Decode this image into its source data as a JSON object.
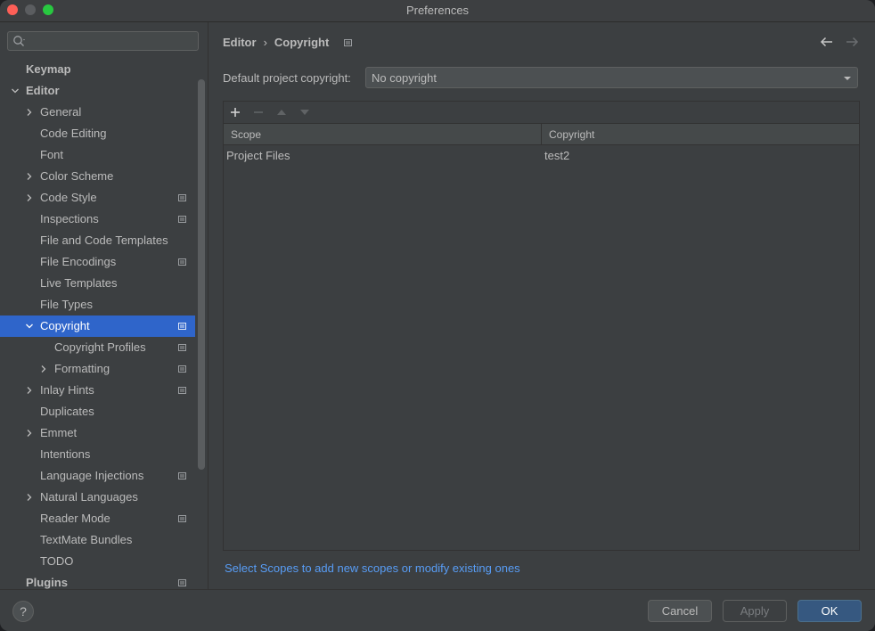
{
  "window": {
    "title": "Preferences"
  },
  "search": {
    "placeholder": ""
  },
  "tree": [
    {
      "label": "Keymap",
      "level": 0,
      "bold": true,
      "arrow": "none",
      "project": false,
      "selected": false
    },
    {
      "label": "Editor",
      "level": 0,
      "bold": true,
      "arrow": "down",
      "project": false,
      "selected": false
    },
    {
      "label": "General",
      "level": 1,
      "bold": false,
      "arrow": "right",
      "project": false,
      "selected": false
    },
    {
      "label": "Code Editing",
      "level": 1,
      "bold": false,
      "arrow": "none",
      "project": false,
      "selected": false
    },
    {
      "label": "Font",
      "level": 1,
      "bold": false,
      "arrow": "none",
      "project": false,
      "selected": false
    },
    {
      "label": "Color Scheme",
      "level": 1,
      "bold": false,
      "arrow": "right",
      "project": false,
      "selected": false
    },
    {
      "label": "Code Style",
      "level": 1,
      "bold": false,
      "arrow": "right",
      "project": true,
      "selected": false
    },
    {
      "label": "Inspections",
      "level": 1,
      "bold": false,
      "arrow": "none",
      "project": true,
      "selected": false
    },
    {
      "label": "File and Code Templates",
      "level": 1,
      "bold": false,
      "arrow": "none",
      "project": false,
      "selected": false
    },
    {
      "label": "File Encodings",
      "level": 1,
      "bold": false,
      "arrow": "none",
      "project": true,
      "selected": false
    },
    {
      "label": "Live Templates",
      "level": 1,
      "bold": false,
      "arrow": "none",
      "project": false,
      "selected": false
    },
    {
      "label": "File Types",
      "level": 1,
      "bold": false,
      "arrow": "none",
      "project": false,
      "selected": false
    },
    {
      "label": "Copyright",
      "level": 1,
      "bold": false,
      "arrow": "down",
      "project": true,
      "selected": true
    },
    {
      "label": "Copyright Profiles",
      "level": 2,
      "bold": false,
      "arrow": "none",
      "project": true,
      "selected": false
    },
    {
      "label": "Formatting",
      "level": 2,
      "bold": false,
      "arrow": "right",
      "project": true,
      "selected": false
    },
    {
      "label": "Inlay Hints",
      "level": 1,
      "bold": false,
      "arrow": "right",
      "project": true,
      "selected": false
    },
    {
      "label": "Duplicates",
      "level": 1,
      "bold": false,
      "arrow": "none",
      "project": false,
      "selected": false
    },
    {
      "label": "Emmet",
      "level": 1,
      "bold": false,
      "arrow": "right",
      "project": false,
      "selected": false
    },
    {
      "label": "Intentions",
      "level": 1,
      "bold": false,
      "arrow": "none",
      "project": false,
      "selected": false
    },
    {
      "label": "Language Injections",
      "level": 1,
      "bold": false,
      "arrow": "none",
      "project": true,
      "selected": false
    },
    {
      "label": "Natural Languages",
      "level": 1,
      "bold": false,
      "arrow": "right",
      "project": false,
      "selected": false
    },
    {
      "label": "Reader Mode",
      "level": 1,
      "bold": false,
      "arrow": "none",
      "project": true,
      "selected": false
    },
    {
      "label": "TextMate Bundles",
      "level": 1,
      "bold": false,
      "arrow": "none",
      "project": false,
      "selected": false
    },
    {
      "label": "TODO",
      "level": 1,
      "bold": false,
      "arrow": "none",
      "project": false,
      "selected": false
    },
    {
      "label": "Plugins",
      "level": 0,
      "bold": true,
      "arrow": "none",
      "project": true,
      "selected": false
    }
  ],
  "breadcrumb": {
    "parent": "Editor",
    "separator": "›",
    "current": "Copyright"
  },
  "default_copyright": {
    "label": "Default project copyright:",
    "value": "No copyright"
  },
  "table": {
    "columns": [
      "Scope",
      "Copyright"
    ],
    "rows": [
      {
        "scope": "Project Files",
        "copyright": "test2"
      }
    ]
  },
  "link": {
    "text": "Select Scopes to add new scopes or modify existing ones"
  },
  "footer": {
    "help": "?",
    "cancel": "Cancel",
    "apply": "Apply",
    "ok": "OK"
  },
  "colors": {
    "accent": "#2f65ca",
    "link": "#589df6",
    "ok_button": "#365880"
  }
}
